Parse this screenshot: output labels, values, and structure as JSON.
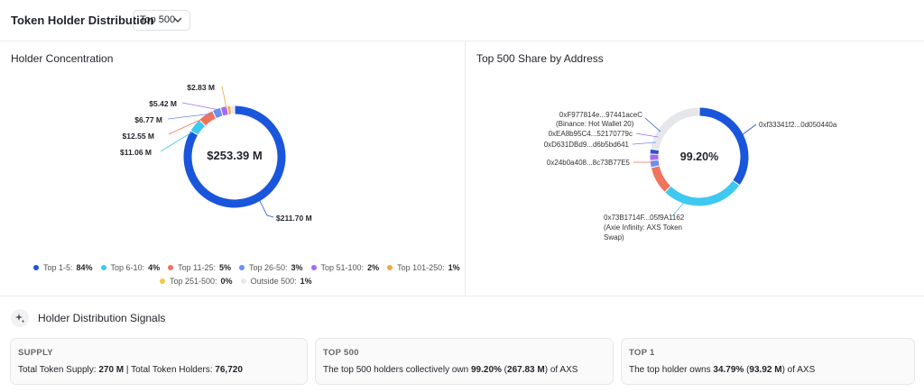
{
  "header": {
    "title": "Token Holder Distribution",
    "filter_value": "Top 500"
  },
  "left_panel": {
    "title": "Holder Concentration",
    "center_value": "$253.39 M",
    "slice_labels": [
      "$211.70 M",
      "$11.06 M",
      "$12.55 M",
      "$6.77 M",
      "$5.42 M",
      "$2.83 M"
    ],
    "legend": [
      {
        "label": "Top 1-5:",
        "pct": "84%",
        "color": "#1a56db"
      },
      {
        "label": "Top 6-10:",
        "pct": "4%",
        "color": "#3fc8f0"
      },
      {
        "label": "Top 11-25:",
        "pct": "5%",
        "color": "#f0735b"
      },
      {
        "label": "Top 26-50:",
        "pct": "3%",
        "color": "#6a8ff5"
      },
      {
        "label": "Top 51-100:",
        "pct": "2%",
        "color": "#a46af2"
      },
      {
        "label": "Top 101-250:",
        "pct": "1%",
        "color": "#f4a64a"
      },
      {
        "label": "Top 251-500:",
        "pct": "0%",
        "color": "#f5c842"
      },
      {
        "label": "Outside 500:",
        "pct": "1%",
        "color": "#e6e7ea"
      }
    ]
  },
  "right_panel": {
    "title": "Top 500 Share by Address",
    "center_value": "99.20%",
    "address_labels": {
      "a1": "0xf33341f2...0d050440a",
      "a2": "0xF977814e...97441aceC",
      "a2_tag": "(Binance: Hot Wallet 20)",
      "a3": "0xEA8b95C4...52170779c",
      "a4": "0xD631DBd9...d6b5bd641",
      "a5": "0x24b0a408...8c73B77E5",
      "a6": "0x73B1714F...05f9A1162",
      "a6_tag_line1": "(Axie Infinity: AXS Token",
      "a6_tag_line2": "Swap)"
    }
  },
  "chart_data": [
    {
      "type": "pie",
      "title": "Holder Concentration",
      "categories": [
        "Top 1-5",
        "Top 6-10",
        "Top 11-25",
        "Top 26-50",
        "Top 51-100",
        "Top 101-250",
        "Top 251-500",
        "Outside 500"
      ],
      "values": [
        211.7,
        11.06,
        12.55,
        6.77,
        5.42,
        2.83,
        0,
        3.06
      ],
      "percent": [
        84,
        4,
        5,
        3,
        2,
        1,
        0,
        1
      ],
      "colors": [
        "#1a56db",
        "#3fc8f0",
        "#f0735b",
        "#6a8ff5",
        "#a46af2",
        "#f4a64a",
        "#f5c842",
        "#e6e7ea"
      ],
      "legend_position": "bottom"
    },
    {
      "type": "pie",
      "title": "Top 500 Share by Address",
      "categories": [
        "0xf33341f2...0d050440a",
        "0x73B1714F...05f9A1162",
        "0x24b0a408...8c73B77E5",
        "0xD631DBd9...d6b5bd641",
        "0xEA8b95C4...52170779c",
        "0xF977814e...97441aceC",
        "Other"
      ],
      "percent": [
        34.79,
        27.5,
        9.2,
        2.3,
        2.1,
        1.7,
        22.41
      ],
      "colors": [
        "#1a56db",
        "#3fc8f0",
        "#f0735b",
        "#6a8ff5",
        "#a46af2",
        "#3452c9",
        "#e6e7ea"
      ]
    }
  ],
  "signals": {
    "title": "Holder Distribution Signals",
    "cards": [
      {
        "caption": "SUPPLY",
        "t1": "Total Token Supply: ",
        "b1": "270 M",
        "t2": " | Total Token Holders: ",
        "b2": "76,720",
        "t3": ""
      },
      {
        "caption": "TOP 500",
        "t1": "The top 500 holders collectively own ",
        "b1": "99.20%",
        "t2": " (",
        "b2": "267.83 M",
        "t3": ") of AXS"
      },
      {
        "caption": "TOP 1",
        "t1": "The top holder owns ",
        "b1": "34.79%",
        "t2": " (",
        "b2": "93.92 M",
        "t3": ") of AXS"
      }
    ]
  }
}
